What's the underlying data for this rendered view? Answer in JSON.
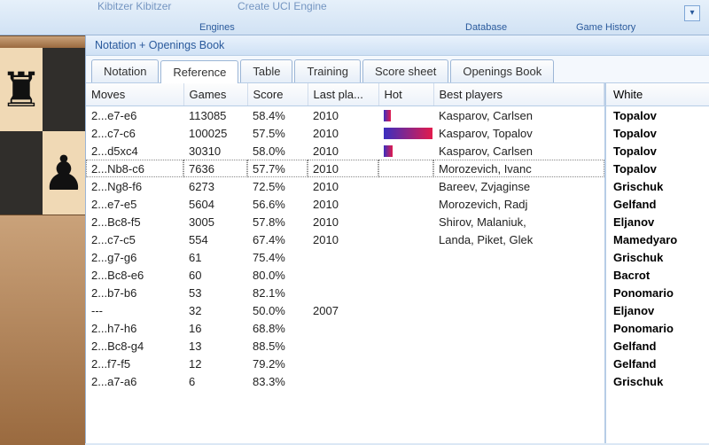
{
  "ribbon": {
    "fragment1": "Kibitzer  Kibitzer",
    "fragment2": "Create UCI Engine",
    "group_engines": "Engines",
    "group_database": "Database",
    "group_history": "Game History"
  },
  "pane_title": "Notation + Openings Book",
  "tabs": [
    {
      "label": "Notation"
    },
    {
      "label": "Reference",
      "active": true
    },
    {
      "label": "Table"
    },
    {
      "label": "Training"
    },
    {
      "label": "Score sheet"
    },
    {
      "label": "Openings Book"
    }
  ],
  "columns": {
    "moves": "Moves",
    "games": "Games",
    "score": "Score",
    "last": "Last pla...",
    "hot": "Hot",
    "best": "Best players"
  },
  "rows": [
    {
      "move": "2...e7-e6",
      "games": "113085",
      "score": "58.4%",
      "last": "2010",
      "hot": 8,
      "best": "Kasparov, Carlsen"
    },
    {
      "move": "2...c7-c6",
      "games": "100025",
      "score": "57.5%",
      "last": "2010",
      "hot": 55,
      "best": "Kasparov, Topalov"
    },
    {
      "move": "2...d5xc4",
      "games": "30310",
      "score": "58.0%",
      "last": "2010",
      "hot": 10,
      "best": "Kasparov, Carlsen"
    },
    {
      "move": "2...Nb8-c6",
      "games": "7636",
      "score": "57.7%",
      "last": "2010",
      "hot": 0,
      "best": "Morozevich, Ivanc",
      "selected": true
    },
    {
      "move": "2...Ng8-f6",
      "games": "6273",
      "score": "72.5%",
      "last": "2010",
      "hot": 0,
      "best": "Bareev, Zvjaginse"
    },
    {
      "move": "2...e7-e5",
      "games": "5604",
      "score": "56.6%",
      "last": "2010",
      "hot": 0,
      "best": "Morozevich, Radj"
    },
    {
      "move": "2...Bc8-f5",
      "games": "3005",
      "score": "57.8%",
      "last": "2010",
      "hot": 0,
      "best": "Shirov, Malaniuk,"
    },
    {
      "move": "2...c7-c5",
      "games": "554",
      "score": "67.4%",
      "last": "2010",
      "hot": 0,
      "best": "Landa, Piket, Glek"
    },
    {
      "move": "2...g7-g6",
      "games": "61",
      "score": "75.4%",
      "last": "",
      "hot": 0,
      "best": ""
    },
    {
      "move": "2...Bc8-e6",
      "games": "60",
      "score": "80.0%",
      "last": "",
      "hot": 0,
      "best": ""
    },
    {
      "move": "2...b7-b6",
      "games": "53",
      "score": "82.1%",
      "last": "",
      "hot": 0,
      "best": ""
    },
    {
      "move": "---",
      "games": "32",
      "score": "50.0%",
      "last": "2007",
      "hot": 0,
      "best": ""
    },
    {
      "move": "2...h7-h6",
      "games": "16",
      "score": "68.8%",
      "last": "",
      "hot": 0,
      "best": ""
    },
    {
      "move": "2...Bc8-g4",
      "games": "13",
      "score": "88.5%",
      "last": "",
      "hot": 0,
      "best": ""
    },
    {
      "move": "2...f7-f5",
      "games": "12",
      "score": "79.2%",
      "last": "",
      "hot": 0,
      "best": ""
    },
    {
      "move": "2...a7-a6",
      "games": "6",
      "score": "83.3%",
      "last": "",
      "hot": 0,
      "best": ""
    }
  ],
  "white_header": "White",
  "white_players": [
    "Topalov",
    "Topalov",
    "Topalov",
    "Topalov",
    "Grischuk",
    "Gelfand",
    "Eljanov",
    "Mamedyaro",
    "Grischuk",
    "Bacrot",
    "Ponomario",
    "Eljanov",
    "Ponomario",
    "Gelfand",
    "Gelfand",
    "Grischuk"
  ],
  "pieces": {
    "rook": "♜",
    "pawn": "♟"
  }
}
